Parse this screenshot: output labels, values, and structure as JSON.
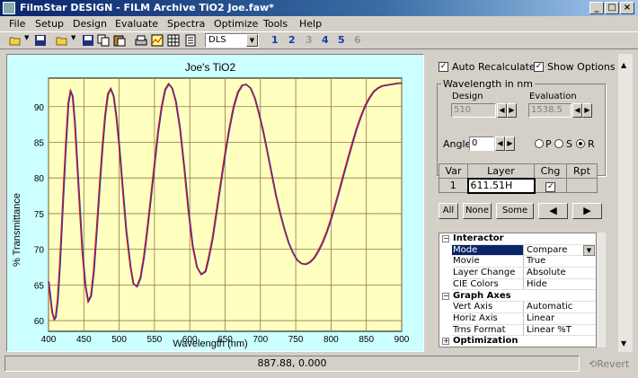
{
  "window": {
    "title": "FilmStar DESIGN - FILM Archive TiO2 Joe.faw*"
  },
  "menu": [
    "File",
    "Setup",
    "Design",
    "Evaluate",
    "Spectra",
    "Optimize",
    "Tools",
    "Help"
  ],
  "toolbar": {
    "combo_value": "DLS",
    "numbers": [
      "1",
      "2",
      "3",
      "4",
      "5",
      "6"
    ]
  },
  "chart_data": {
    "type": "line",
    "title": "Joe's TiO2",
    "xlabel": "Wavelength (nm)",
    "ylabel": "% Transmittance",
    "xlim": [
      400,
      900
    ],
    "ylim": [
      58.5,
      94
    ],
    "xticks": [
      400,
      450,
      500,
      550,
      600,
      650,
      700,
      750,
      800,
      850,
      900
    ],
    "yticks": [
      60,
      65,
      70,
      75,
      80,
      85,
      90
    ],
    "grid": true,
    "series": [
      {
        "color": "#e01010",
        "x": [
          400,
          405,
          408,
          410,
          413,
          416,
          420,
          424,
          428,
          431,
          434,
          437,
          440,
          444,
          448,
          452,
          456,
          460,
          464,
          468,
          472,
          476,
          480,
          484,
          488,
          492,
          496,
          500,
          505,
          510,
          516,
          520,
          525,
          530,
          535,
          540,
          545,
          550,
          555,
          560,
          565,
          570,
          575,
          580,
          586,
          592,
          598,
          604,
          610,
          616,
          622,
          626,
          632,
          638,
          644,
          650,
          656,
          662,
          668,
          674,
          680,
          686,
          692,
          698,
          704,
          710,
          716,
          722,
          728,
          734,
          740,
          746,
          752,
          758,
          764,
          770,
          776,
          782,
          788,
          794,
          800,
          806,
          812,
          818,
          824,
          830,
          836,
          842,
          848,
          854,
          860,
          866,
          872,
          878,
          884,
          890,
          896,
          900
        ],
        "y": [
          65.5,
          61.2,
          60.2,
          60.5,
          63,
          68,
          76,
          84,
          90.5,
          92.2,
          91.5,
          88,
          83,
          76,
          69.5,
          65,
          62.7,
          63.5,
          67,
          72.5,
          78.5,
          84,
          88.8,
          91.8,
          92.5,
          91.5,
          88.5,
          84.5,
          78.5,
          72.5,
          67.5,
          65.2,
          64.8,
          66,
          69,
          73,
          77.5,
          82,
          86.5,
          90,
          92.4,
          93.2,
          92.6,
          90.8,
          87,
          81.5,
          75.5,
          70.5,
          67.5,
          66.5,
          66.9,
          68.5,
          71.5,
          75.5,
          79.5,
          83.5,
          87,
          90,
          92,
          93,
          93.1,
          92.6,
          91.2,
          89,
          86.5,
          83.5,
          80.5,
          77.5,
          75,
          72.8,
          70.9,
          69.5,
          68.5,
          68,
          67.9,
          68.2,
          68.8,
          69.8,
          71,
          72.5,
          74.3,
          76.3,
          78.4,
          80.6,
          82.8,
          84.9,
          86.9,
          88.6,
          90.1,
          91.2,
          92.1,
          92.6,
          92.9,
          93,
          93.1,
          93.2,
          93.3,
          93.3
        ]
      }
    ]
  },
  "options": {
    "auto_recalc": "Auto Recalculate",
    "show_options": "Show Options",
    "wavelength_group": "Wavelength in nm",
    "design_label": "Design",
    "design_value": "510",
    "eval_label": "Evaluation",
    "eval_value": "1538.5",
    "angle_label": "Angle",
    "angle_value": "0",
    "pol_p": "P",
    "pol_s": "S",
    "pol_r": "R"
  },
  "layer_table": {
    "headers": [
      "Var",
      "Layer",
      "Chg",
      "Rpt"
    ],
    "row": {
      "var": "1",
      "layer": "611.51H"
    }
  },
  "buttons": {
    "all": "All",
    "none": "None",
    "some": "Some"
  },
  "grid": [
    {
      "type": "cat",
      "name": "Interactor",
      "ex": "−"
    },
    {
      "name": "Mode",
      "value": "Compare",
      "sel": true
    },
    {
      "name": "Movie",
      "value": "True"
    },
    {
      "name": "Layer Change",
      "value": "Absolute"
    },
    {
      "name": "CIE Colors",
      "value": "Hide"
    },
    {
      "type": "cat",
      "name": "Graph Axes",
      "ex": "−"
    },
    {
      "name": "Vert Axis",
      "value": "Automatic"
    },
    {
      "name": "Horiz Axis",
      "value": "Linear"
    },
    {
      "name": "Trns Format",
      "value": "Linear %T"
    },
    {
      "type": "cat",
      "name": "Optimization",
      "ex": "+"
    }
  ],
  "status": {
    "coords": "887.88, 0.000",
    "revert": "Revert"
  }
}
